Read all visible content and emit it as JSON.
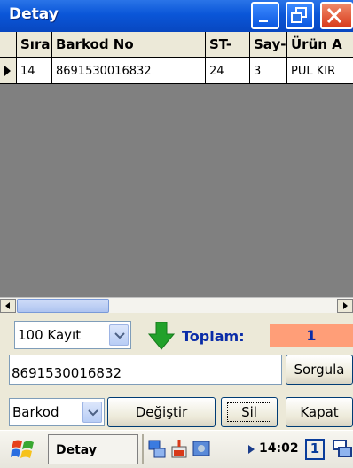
{
  "window": {
    "title": "Detay"
  },
  "grid": {
    "columns": [
      "Sıra",
      "Barkod No",
      "ST-",
      "Say-",
      "Ürün A"
    ],
    "rows": [
      {
        "sira": "14",
        "barkod": "8691530016832",
        "st": "24",
        "say": "3",
        "urun": "PUL KIR"
      }
    ]
  },
  "controls": {
    "record_select": "100 Kayıt",
    "toplam_label": "Toplam:",
    "toplam_value": "1",
    "barcode_value": "8691530016832",
    "sorgula_label": "Sorgula",
    "field_select": "Barkod",
    "degistir_label": "Değiştir",
    "sil_label": "Sil",
    "kapat_label": "Kapat"
  },
  "taskbar": {
    "task_label": "Detay",
    "clock": "14:02",
    "desktop_number": "1"
  },
  "colors": {
    "titlebar": "#0a56d8",
    "toplam_bg": "#ff9e78",
    "toplam_text": "#0a2ca8",
    "grid_bg": "#808080"
  },
  "icons": [
    "minimize-icon",
    "maximize-icon",
    "close-icon",
    "row-pointer-icon",
    "green-down-arrow-icon",
    "windows-flag-icon",
    "network-icon",
    "battery-icon",
    "connection-icon",
    "desktop-switch-icon"
  ]
}
